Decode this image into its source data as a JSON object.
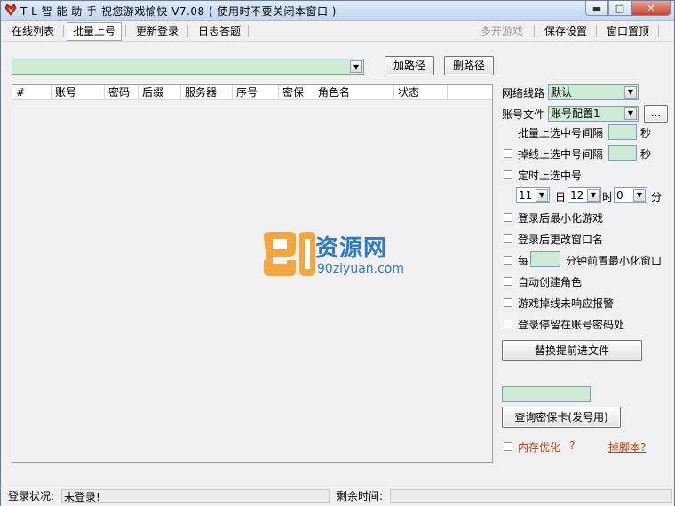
{
  "window": {
    "title": "T L 智 能 助 手 祝您游戏愉快 V7.08 ( 使用时不要关闭本窗口 )",
    "controls": {
      "minimize": "▬",
      "maximize": "□",
      "close": "✕"
    }
  },
  "menu": {
    "tabs": [
      "在线列表",
      "批量上号",
      "更新登录",
      "日志答题"
    ],
    "right": [
      "多开游戏",
      "保存设置",
      "窗口置顶"
    ]
  },
  "path": {
    "value": "",
    "add_label": "加路径",
    "remove_label": "删路径"
  },
  "table": {
    "columns": [
      "#",
      "账号",
      "密码",
      "后缀",
      "服务器",
      "序号",
      "密保",
      "角色名",
      "状态"
    ]
  },
  "watermark": {
    "text_cn": "资源网",
    "text_en": "90ziyuan.com"
  },
  "settings": {
    "network_label": "网络线路",
    "network_value": "默认",
    "account_file_label": "账号文件",
    "account_file_value": "账号配置1",
    "browse_label": "...",
    "batch_interval_label": "批量上选中号间隔",
    "sec1": "秒",
    "drop_interval_label": "掉线上选中号间隔",
    "sec2": "秒",
    "timed_label": "定时上选中号",
    "day_value": "11",
    "day_unit": "日",
    "hour_value": "12",
    "hour_unit": "时",
    "min_value": "0",
    "min_unit": "分",
    "minimize_after_login": "登录后最小化游戏",
    "rename_after_login": "登录后更改窗口名",
    "every_label": "每",
    "every_suffix": "分钟前置最小化窗口",
    "auto_create_role": "自动创建角色",
    "drop_alarm": "游戏掉线未响应报警",
    "stay_on_login": "登录停留在账号密码处",
    "replace_file_button": "替换提前进文件",
    "card_value": "",
    "query_card_button": "查询密保卡(发号用)",
    "mem_opt": "内存优化",
    "mem_help": "?",
    "drop_script": "掉脚本?"
  },
  "status": {
    "login_label": "登录状况:",
    "login_value": "未登录!",
    "remain_label": "剩余时间:",
    "remain_value": ""
  },
  "colors": {
    "field_green": "#cdecd5",
    "link_orange": "#b5420e",
    "watermark_blue": "#2f7ac0",
    "watermark_orange": "#f39a1e"
  }
}
